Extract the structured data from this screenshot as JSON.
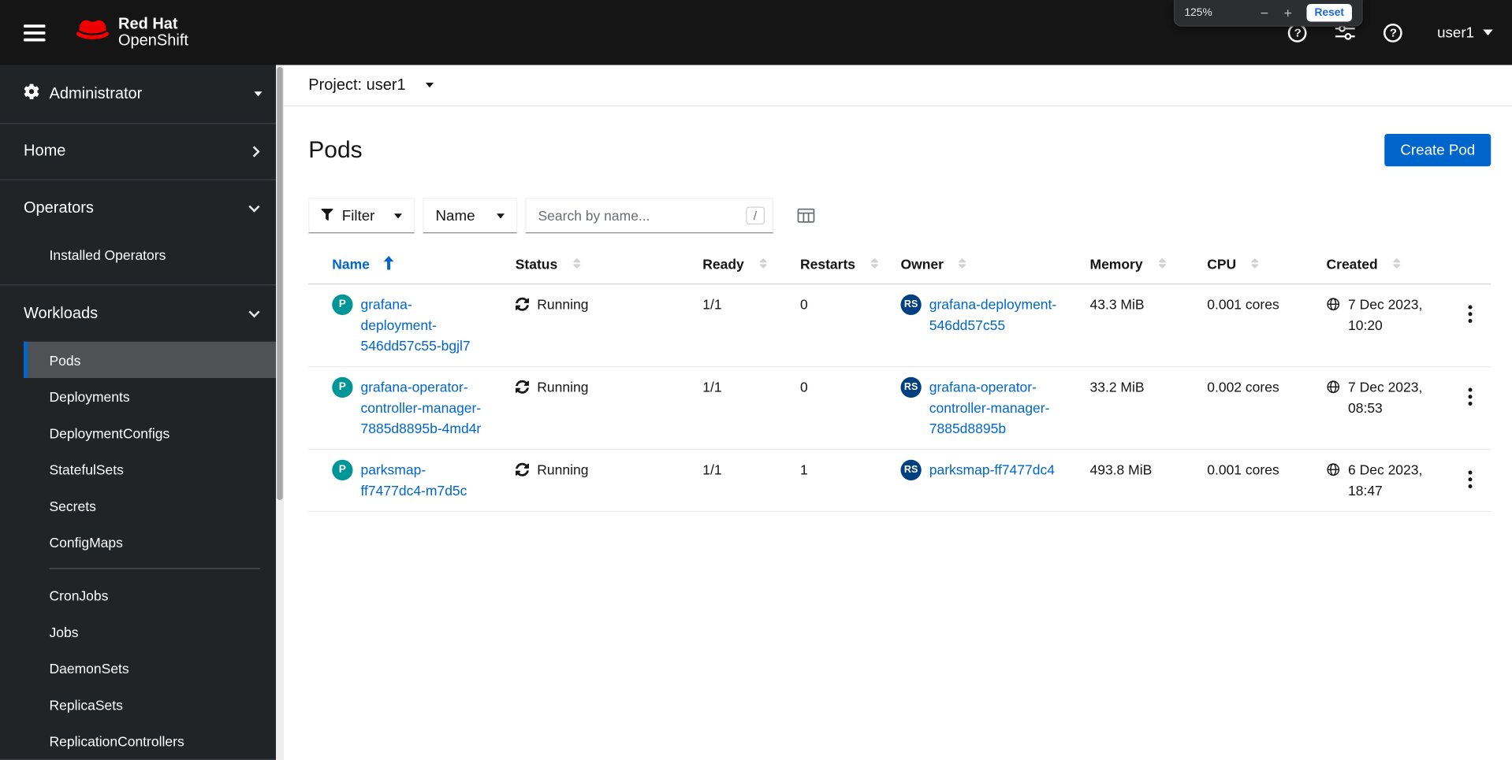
{
  "masthead": {
    "brand": {
      "line1": "Red Hat",
      "line2": "OpenShift"
    },
    "zoom_popup": {
      "level": "125%",
      "minus_label": "−",
      "plus_label": "+",
      "reset_label": "Reset"
    },
    "icons": {
      "question_glyph": "?"
    },
    "username": "user1"
  },
  "sidebar": {
    "perspective": "Administrator",
    "home_label": "Home",
    "operators": {
      "label": "Operators",
      "children": [
        "Installed Operators"
      ]
    },
    "workloads": {
      "label": "Workloads",
      "selected": "Pods",
      "children": [
        "Pods",
        "Deployments",
        "DeploymentConfigs",
        "StatefulSets",
        "Secrets",
        "ConfigMaps",
        "CronJobs",
        "Jobs",
        "DaemonSets",
        "ReplicaSets",
        "ReplicationControllers"
      ]
    }
  },
  "project_bar": {
    "label": "Project:",
    "value": "user1"
  },
  "page": {
    "title": "Pods",
    "create_button_label": "Create Pod"
  },
  "toolbar": {
    "filter_label": "Filter",
    "attribute_label": "Name",
    "search_placeholder": "Search by name...",
    "search_shortcut": "/"
  },
  "table": {
    "columns": {
      "name": "Name",
      "status": "Status",
      "ready": "Ready",
      "restarts": "Restarts",
      "owner": "Owner",
      "memory": "Memory",
      "cpu": "CPU",
      "created": "Created"
    },
    "badges": {
      "pod": "P",
      "replicaset": "RS"
    },
    "rows": [
      {
        "name": "grafana-deployment-546dd57c55-bgjl7",
        "status": "Running",
        "ready": "1/1",
        "restarts": "0",
        "owner": "grafana-deployment-546dd57c55",
        "memory": "43.3 MiB",
        "cpu": "0.001 cores",
        "created": "7 Dec 2023, 10:20"
      },
      {
        "name": "grafana-operator-controller-manager-7885d8895b-4md4r",
        "status": "Running",
        "ready": "1/1",
        "restarts": "0",
        "owner": "grafana-operator-controller-manager-7885d8895b",
        "memory": "33.2 MiB",
        "cpu": "0.002 cores",
        "created": "7 Dec 2023, 08:53"
      },
      {
        "name": "parksmap-ff7477dc4-m7d5c",
        "status": "Running",
        "ready": "1/1",
        "restarts": "1",
        "owner": "parksmap-ff7477dc4",
        "memory": "493.8 MiB",
        "cpu": "0.001 cores",
        "created": "6 Dec 2023, 18:47"
      }
    ]
  },
  "colors": {
    "accent": "#0066cc",
    "link": "#0066cc",
    "masthead_bg": "#151515",
    "sidebar_bg": "#212427",
    "pod_badge": "#009596",
    "replicaset_badge": "#004080"
  }
}
